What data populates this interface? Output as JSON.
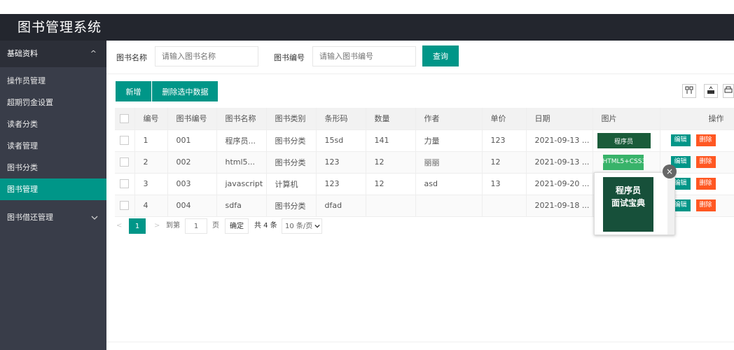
{
  "header": {
    "title": "图书管理系统"
  },
  "sidebar": {
    "group1": {
      "label": "基础资料",
      "arrow": "^"
    },
    "items": [
      {
        "label": "操作员管理"
      },
      {
        "label": "超期罚金设置"
      },
      {
        "label": "读者分类"
      },
      {
        "label": "读者管理"
      },
      {
        "label": "图书分类"
      },
      {
        "label": "图书管理"
      }
    ],
    "group2": {
      "label": "图书借还管理",
      "arrow": "v"
    }
  },
  "search": {
    "name_label": "图书名称",
    "name_placeholder": "请输入图书名称",
    "code_label": "图书编号",
    "code_placeholder": "请输入图书编号",
    "query_button": "查询"
  },
  "toolbar": {
    "add_button": "新增",
    "delete_selected_button": "删除选中数据",
    "icons": [
      "columns-icon",
      "export-icon",
      "print-icon"
    ]
  },
  "table": {
    "headers": [
      "编号",
      "图书编号",
      "图书名称",
      "图书类别",
      "条形码",
      "数量",
      "作者",
      "单价",
      "日期",
      "图片",
      "操作"
    ],
    "rows": [
      {
        "id": "1",
        "code": "001",
        "name": "程序员...",
        "category": "图书分类",
        "barcode": "15sd",
        "qty": "141",
        "author": "力量",
        "price": "123",
        "date": "2021-09-13 ...",
        "cover": "程序员"
      },
      {
        "id": "2",
        "code": "002",
        "name": "html5...",
        "category": "图书分类",
        "barcode": "123",
        "qty": "12",
        "author": "丽丽",
        "price": "12",
        "date": "2021-09-13 ...",
        "cover": "HTML5+CSS3"
      },
      {
        "id": "3",
        "code": "003",
        "name": "javascript",
        "category": "计算机",
        "barcode": "123",
        "qty": "12",
        "author": "asd",
        "price": "13",
        "date": "2021-09-20 ...",
        "cover": ""
      },
      {
        "id": "4",
        "code": "004",
        "name": "sdfa",
        "category": "图书分类",
        "barcode": "dfad",
        "qty": "",
        "author": "",
        "price": "",
        "date": "2021-09-18 ...",
        "cover": ""
      }
    ],
    "edit_label": "编辑",
    "delete_label": "删除"
  },
  "pager": {
    "prev": "<",
    "current_page": "1",
    "next": ">",
    "goto_label": "到第",
    "goto_value": "1",
    "page_unit": "页",
    "confirm": "确定",
    "total": "共 4 条",
    "page_size": "10 条/页"
  },
  "popup": {
    "close": "×",
    "cover_line1": "程序员",
    "cover_line2": "面试宝典"
  },
  "colors": {
    "accent": "#009688",
    "danger": "#ff5722",
    "sidebar": "#393d49",
    "header": "#23262e"
  }
}
